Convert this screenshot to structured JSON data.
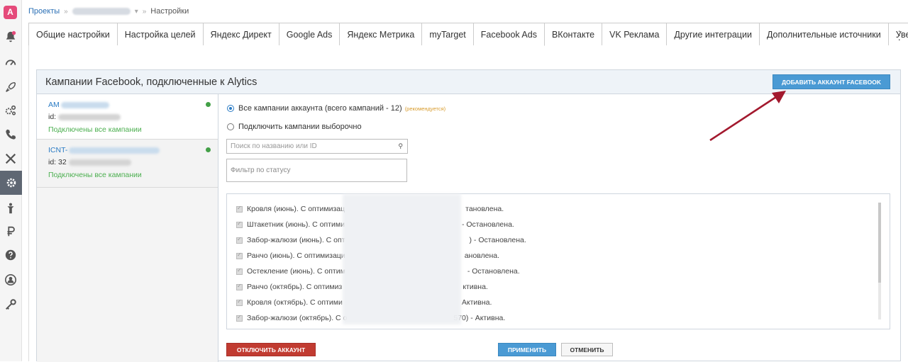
{
  "breadcrumb": {
    "root": "Проекты",
    "current": "Настройки"
  },
  "tabs": [
    {
      "label": "Общие настройки"
    },
    {
      "label": "Настройка целей"
    },
    {
      "label": "Яндекс Директ"
    },
    {
      "label": "Google Ads"
    },
    {
      "label": "Яндекс Метрика"
    },
    {
      "label": "myTarget"
    },
    {
      "label": "Facebook Ads",
      "active": true
    },
    {
      "label": "ВКонтакте"
    },
    {
      "label": "VK Реклама"
    },
    {
      "label": "Другие интеграции"
    },
    {
      "label": "Дополнительные источники"
    },
    {
      "label": "Уведомле"
    }
  ],
  "panel": {
    "title": "Кампании Facebook, подключенные к Alytics",
    "add_button": "ДОБАВИТЬ АККАУНТ FACEBOOK"
  },
  "accounts": [
    {
      "name_prefix": "AM",
      "id_prefix": "id:",
      "status": "Подключены все кампании"
    },
    {
      "name_prefix": "ICNT-",
      "id_prefix": "id: 32",
      "status": "Подключены все кампании"
    }
  ],
  "options": {
    "all_label": "Все кампании аккаунта (всего кампаний - 12)",
    "recommended": "(рекомендуется)",
    "selective_label": "Подключить кампании выборочно"
  },
  "search": {
    "placeholder": "Поиск по названию или ID"
  },
  "filter": {
    "placeholder": "Фильтр по статусу"
  },
  "campaigns": [
    {
      "label": "Кровля (июнь). С оптимизац",
      "suffix": "тановлена."
    },
    {
      "label": "Штакетник (июнь). С оптими",
      "suffix": "- Остановлена."
    },
    {
      "label": "Забор-жалюзи (июнь). С опт",
      "suffix": ") - Остановлена."
    },
    {
      "label": "Ранчо (июнь). С оптимизаци",
      "suffix": "ановлена."
    },
    {
      "label": "Остекление (июнь). С оптим",
      "suffix": "- Остановлена."
    },
    {
      "label": "Ранчо (октябрь). С оптимиз",
      "suffix": "ктивна."
    },
    {
      "label": "Кровля (октябрь). С оптими",
      "suffix": "Активна."
    },
    {
      "label": "Забор-жалюзи (октябрь). С о",
      "suffix": "570) - Активна."
    }
  ],
  "buttons": {
    "disconnect": "ОТКЛЮЧИТЬ АККАУНТ",
    "apply": "ПРИМЕНИТЬ",
    "cancel": "ОТМЕНИТЬ"
  },
  "logo_letter": "A",
  "colors": {
    "brand": "#e54a7a",
    "primary_button": "#4a9ad4",
    "danger_button": "#c13b31",
    "status_green": "#4caf50",
    "annotation_arrow": "#a3192e"
  }
}
